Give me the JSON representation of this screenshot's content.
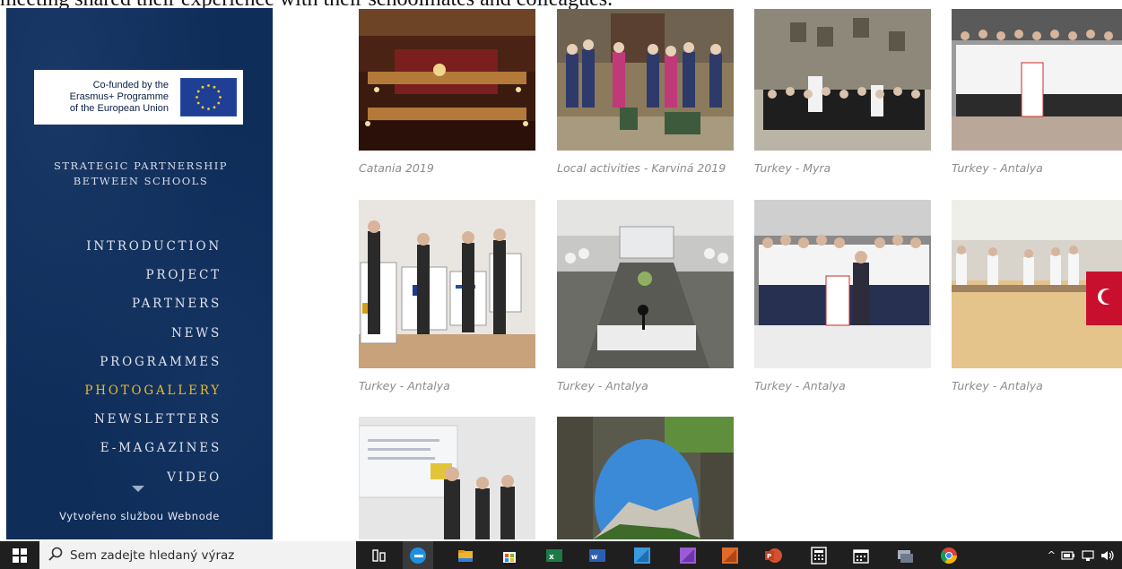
{
  "page": {
    "top_caption": "meeting shared their experience with their schoolmates and colleagues."
  },
  "sidebar": {
    "logo": {
      "line1": "Co-funded by the",
      "line2": "Erasmus+ Programme",
      "line3": "of the European Union"
    },
    "tagline_line1": "STRATEGIC PARTNERSHIP",
    "tagline_line2": "BETWEEN SCHOOLS",
    "nav": [
      {
        "label": "INTRODUCTION",
        "active": false
      },
      {
        "label": "PROJECT",
        "active": false
      },
      {
        "label": "PARTNERS",
        "active": false
      },
      {
        "label": "NEWS",
        "active": false
      },
      {
        "label": "PROGRAMMES",
        "active": false
      },
      {
        "label": "PHOTOGALLERY",
        "active": true
      },
      {
        "label": "NEWSLETTERS",
        "active": false
      },
      {
        "label": "E-MAGAZINES",
        "active": false
      },
      {
        "label": "VIDEO",
        "active": false
      }
    ],
    "footer": "Vytvořeno službou Webnode",
    "colors": {
      "background": "#0f2d59",
      "active": "#e9bb2a",
      "text": "#dfe4ee"
    }
  },
  "gallery": {
    "items": [
      {
        "caption": "Catania 2019",
        "icon": "theatre-photo"
      },
      {
        "caption": "Local activities - Karviná 2019",
        "icon": "group-photo"
      },
      {
        "caption": "Turkey - Myra",
        "icon": "ruins-group-photo"
      },
      {
        "caption": "Turkey - Antalya",
        "icon": "group-photo"
      },
      {
        "caption": "Turkey - Antalya",
        "icon": "posters-photo"
      },
      {
        "caption": "Turkey - Antalya",
        "icon": "conference-photo"
      },
      {
        "caption": "Turkey - Antalya",
        "icon": "group-photo"
      },
      {
        "caption": "Turkey - Antalya",
        "icon": "hall-photo"
      },
      {
        "caption": "",
        "icon": "presentation-photo"
      },
      {
        "caption": "",
        "icon": "arch-mountain-photo"
      }
    ]
  },
  "taskbar": {
    "search_placeholder": "Sem zadejte hledaný výraz",
    "apps": [
      "task-view-icon",
      "edge-icon",
      "file-explorer-icon",
      "store-icon",
      "excel-icon",
      "word-icon",
      "app-blue-icon",
      "app-purple-icon",
      "app-orange-icon",
      "powerpoint-icon",
      "calculator-icon",
      "calendar-icon",
      "app-grey-icon",
      "chrome-icon"
    ],
    "tray": "^"
  }
}
